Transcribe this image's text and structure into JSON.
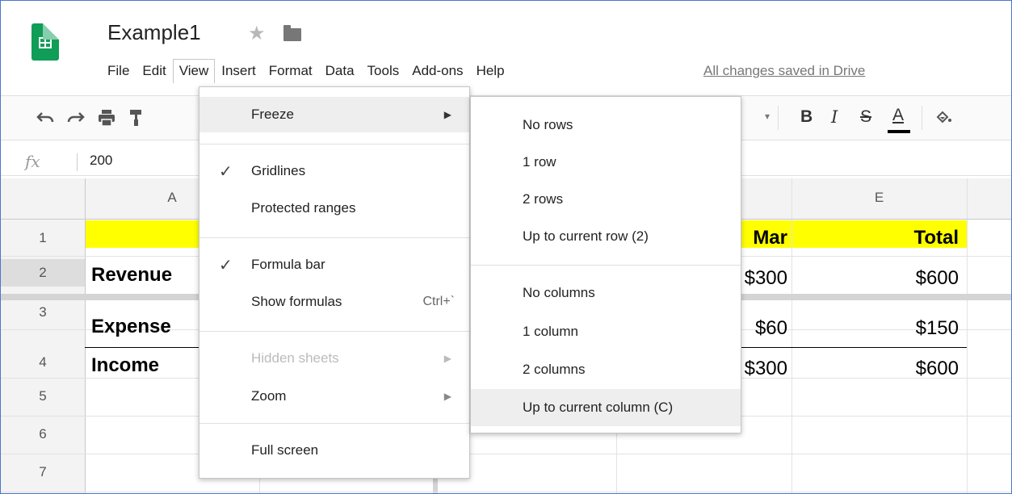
{
  "header": {
    "doc_title": "Example1",
    "star_icon": "★",
    "saved_status": "All changes saved in Drive"
  },
  "menubar": [
    "File",
    "Edit",
    "View",
    "Insert",
    "Format",
    "Data",
    "Tools",
    "Add-ons",
    "Help"
  ],
  "formula_bar": {
    "fx": "fx",
    "value": "200"
  },
  "toolbar_icons": [
    "undo-icon",
    "redo-icon",
    "print-icon",
    "paint-format-icon",
    "bold-icon",
    "italic-icon",
    "strikethrough-icon",
    "text-color-icon",
    "fill-color-icon"
  ],
  "toolbar": {
    "bold": "B",
    "italic": "I",
    "strike": "S",
    "text_color": "A"
  },
  "grid": {
    "columns": [
      "A",
      "E"
    ],
    "rows": [
      "1",
      "2",
      "3",
      "4",
      "5",
      "6",
      "7"
    ],
    "cells": {
      "a2": "Revenue",
      "a3": "Expense",
      "a4": "Income",
      "d1": "Mar",
      "d2": "$300",
      "d3": "$60",
      "d4": "$300",
      "e1": "Total",
      "e2": "$600",
      "e3": "$150",
      "e4": "$600"
    }
  },
  "view_menu": {
    "items": [
      {
        "label": "Freeze"
      },
      {
        "label": "Gridlines",
        "check": "✓"
      },
      {
        "label": "Protected ranges"
      },
      {
        "label": "Formula bar",
        "check": "✓"
      },
      {
        "label": "Show formulas",
        "shortcut": "Ctrl+`"
      },
      {
        "label": "Hidden sheets"
      },
      {
        "label": "Zoom"
      },
      {
        "label": "Full screen"
      }
    ]
  },
  "freeze_submenu": {
    "items": [
      "No rows",
      "1 row",
      "2 rows",
      "Up to current row (2)",
      "No columns",
      "1 column",
      "2 columns",
      "Up to current column (C)"
    ]
  },
  "colors": {
    "highlight_yellow": "#ffff00",
    "sheets_green": "#0f9d58",
    "frame_blue": "#4a77c9"
  }
}
